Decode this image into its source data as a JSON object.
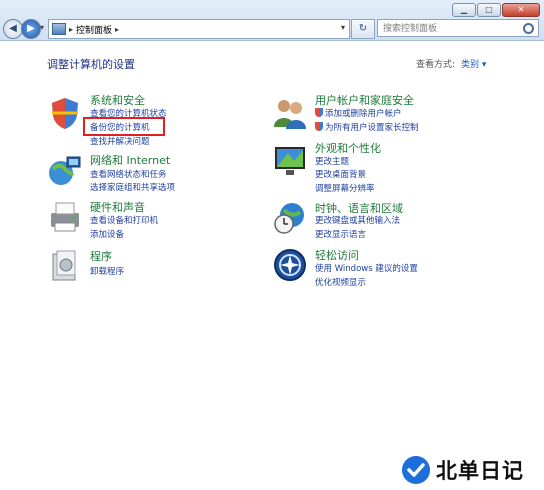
{
  "window": {
    "minimize": "▁",
    "maximize": "□",
    "close": "✕"
  },
  "toolbar": {
    "back": "◀",
    "forward": "▶",
    "nav_dropdown": "▾",
    "breadcrumb_sep": "▸",
    "breadcrumb_current": "控制面板",
    "address_dropdown": "▾",
    "refresh": "↻",
    "search_placeholder": "搜索控制面板"
  },
  "page": {
    "heading": "调整计算机的设置",
    "view_by_label": "查看方式:",
    "view_by_value": "类别 ▾"
  },
  "categories_left": [
    {
      "id": "system-security",
      "title": "系统和安全",
      "icon": "shield-icon",
      "links": [
        "查看您的计算机状态",
        "备份您的计算机",
        "查找并解决问题"
      ]
    },
    {
      "id": "network",
      "title": "网络和 Internet",
      "icon": "network-globe-icon",
      "links": [
        "查看网络状态和任务",
        "选择家庭组和共享选项"
      ]
    },
    {
      "id": "hardware",
      "title": "硬件和声音",
      "icon": "printer-icon",
      "links": [
        "查看设备和打印机",
        "添加设备"
      ]
    },
    {
      "id": "programs",
      "title": "程序",
      "icon": "programs-icon",
      "links": [
        "卸载程序"
      ]
    }
  ],
  "categories_right": [
    {
      "id": "user-accounts",
      "title": "用户帐户和家庭安全",
      "icon": "users-icon",
      "links": [
        "添加或删除用户帐户",
        "为所有用户设置家长控制"
      ]
    },
    {
      "id": "appearance",
      "title": "外观和个性化",
      "icon": "monitor-icon",
      "links": [
        "更改主题",
        "更改桌面背景",
        "调整屏幕分辨率"
      ]
    },
    {
      "id": "clock-region",
      "title": "时钟、语言和区域",
      "icon": "clock-globe-icon",
      "links": [
        "更改键盘或其他输入法",
        "更改显示语言"
      ]
    },
    {
      "id": "ease-of-access",
      "title": "轻松访问",
      "icon": "ease-of-access-icon",
      "links": [
        "使用 Windows 建议的设置",
        "优化视频显示"
      ]
    }
  ],
  "watermark": {
    "text": "北单日记",
    "icon": "checkmark-logo-icon"
  },
  "colors": {
    "accent_link": "#1e3fa0",
    "category_title": "#1e7a3c",
    "highlight_box": "#e02020"
  }
}
